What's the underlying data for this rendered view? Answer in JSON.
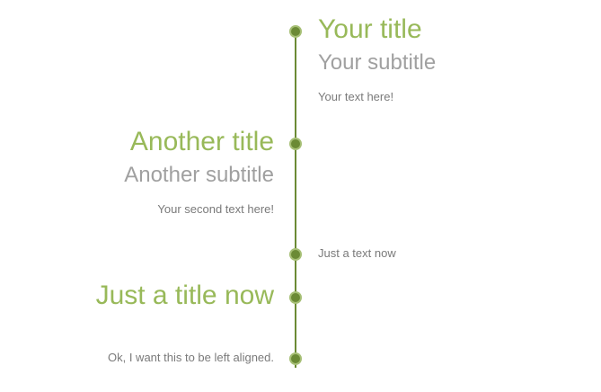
{
  "colors": {
    "accent": "#98b959",
    "line": "#6b8a35",
    "subtitle": "#a0a0a0",
    "text": "#7a7a7a"
  },
  "timeline": {
    "items": [
      {
        "title": "Your title",
        "subtitle": "Your subtitle",
        "text": "Your text here!"
      },
      {
        "title": "Another title",
        "subtitle": "Another subtitle",
        "text": "Your second text here!"
      },
      {
        "text": "Just a text now"
      },
      {
        "title": "Just a title now"
      },
      {
        "text": "Ok, I want this to be left aligned."
      }
    ]
  }
}
